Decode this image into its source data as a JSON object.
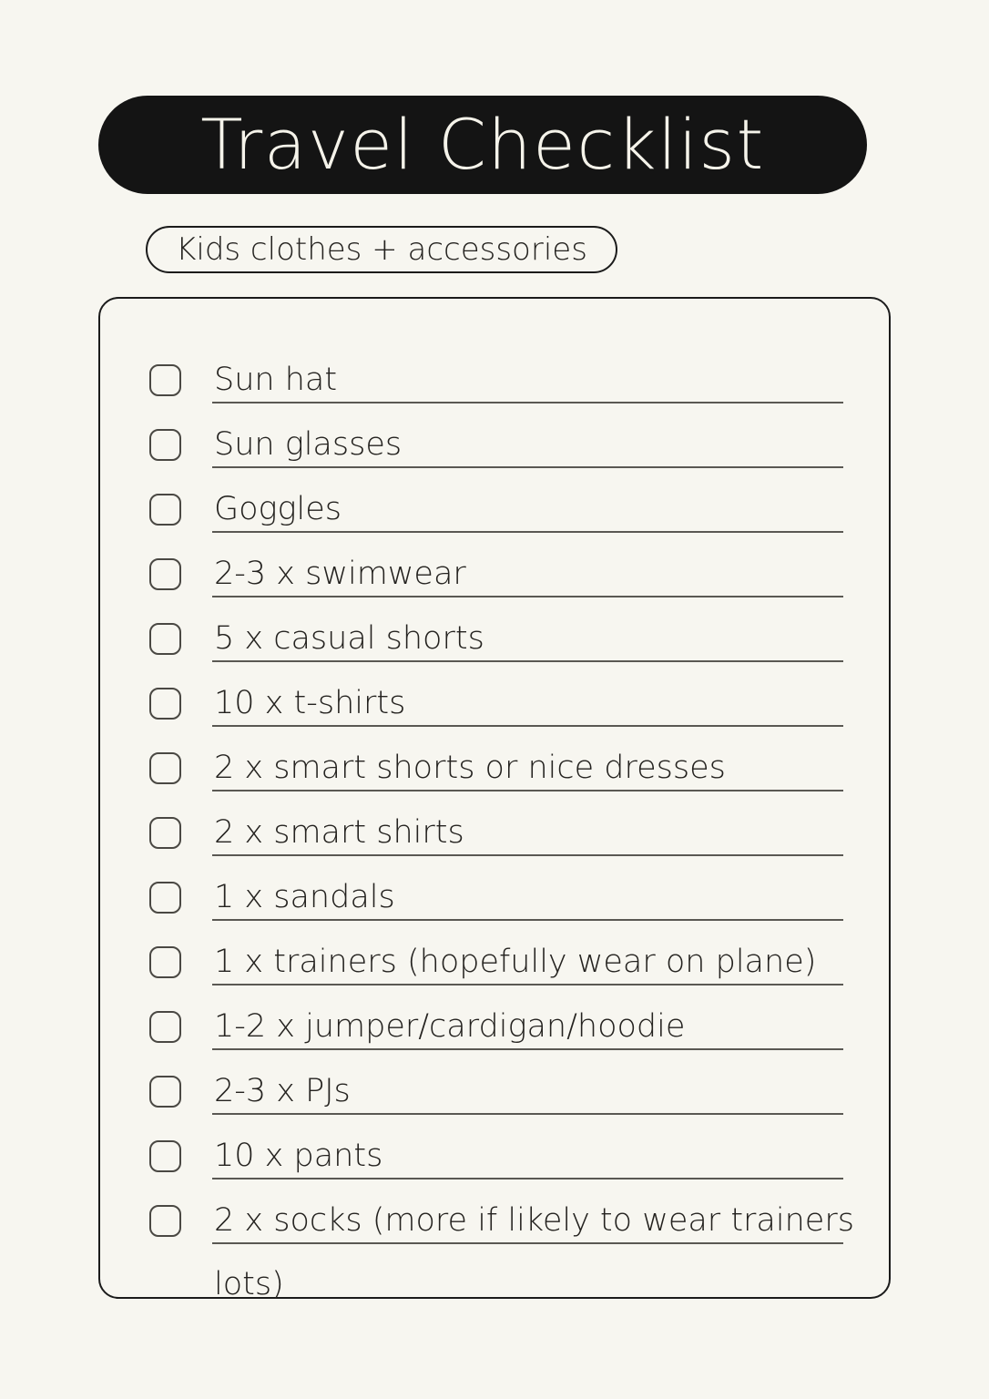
{
  "colors": {
    "background": "#f7f6f0",
    "title_pill_bg": "#141414",
    "title_text": "#f5f3ea",
    "body_text": "#24221f",
    "outline": "#1b1b1b",
    "rule": "#5a5853",
    "checkbox_border": "#4a4843"
  },
  "header": {
    "title": "Travel Checklist",
    "subtitle": "Kids clothes + accessories"
  },
  "checklist": {
    "items": [
      {
        "label": "Sun hat",
        "checked": false
      },
      {
        "label": "Sun glasses",
        "checked": false
      },
      {
        "label": "Goggles",
        "checked": false
      },
      {
        "label": "2-3 x swimwear",
        "checked": false
      },
      {
        "label": "5 x casual shorts",
        "checked": false
      },
      {
        "label": "10 x t-shirts",
        "checked": false
      },
      {
        "label": "2 x smart shorts or nice dresses",
        "checked": false
      },
      {
        "label": "2 x smart shirts",
        "checked": false
      },
      {
        "label": "1 x sandals",
        "checked": false
      },
      {
        "label": "1 x trainers (hopefully wear on plane)",
        "checked": false
      },
      {
        "label": "1-2 x jumper/cardigan/hoodie",
        "checked": false
      },
      {
        "label": "2-3 x PJs",
        "checked": false
      },
      {
        "label": "10 x pants",
        "checked": false
      },
      {
        "label": "2 x socks (more if likely to wear trainers",
        "label_overflow": "lots)",
        "checked": false
      }
    ],
    "total_items": 14,
    "checked_count": 0
  }
}
